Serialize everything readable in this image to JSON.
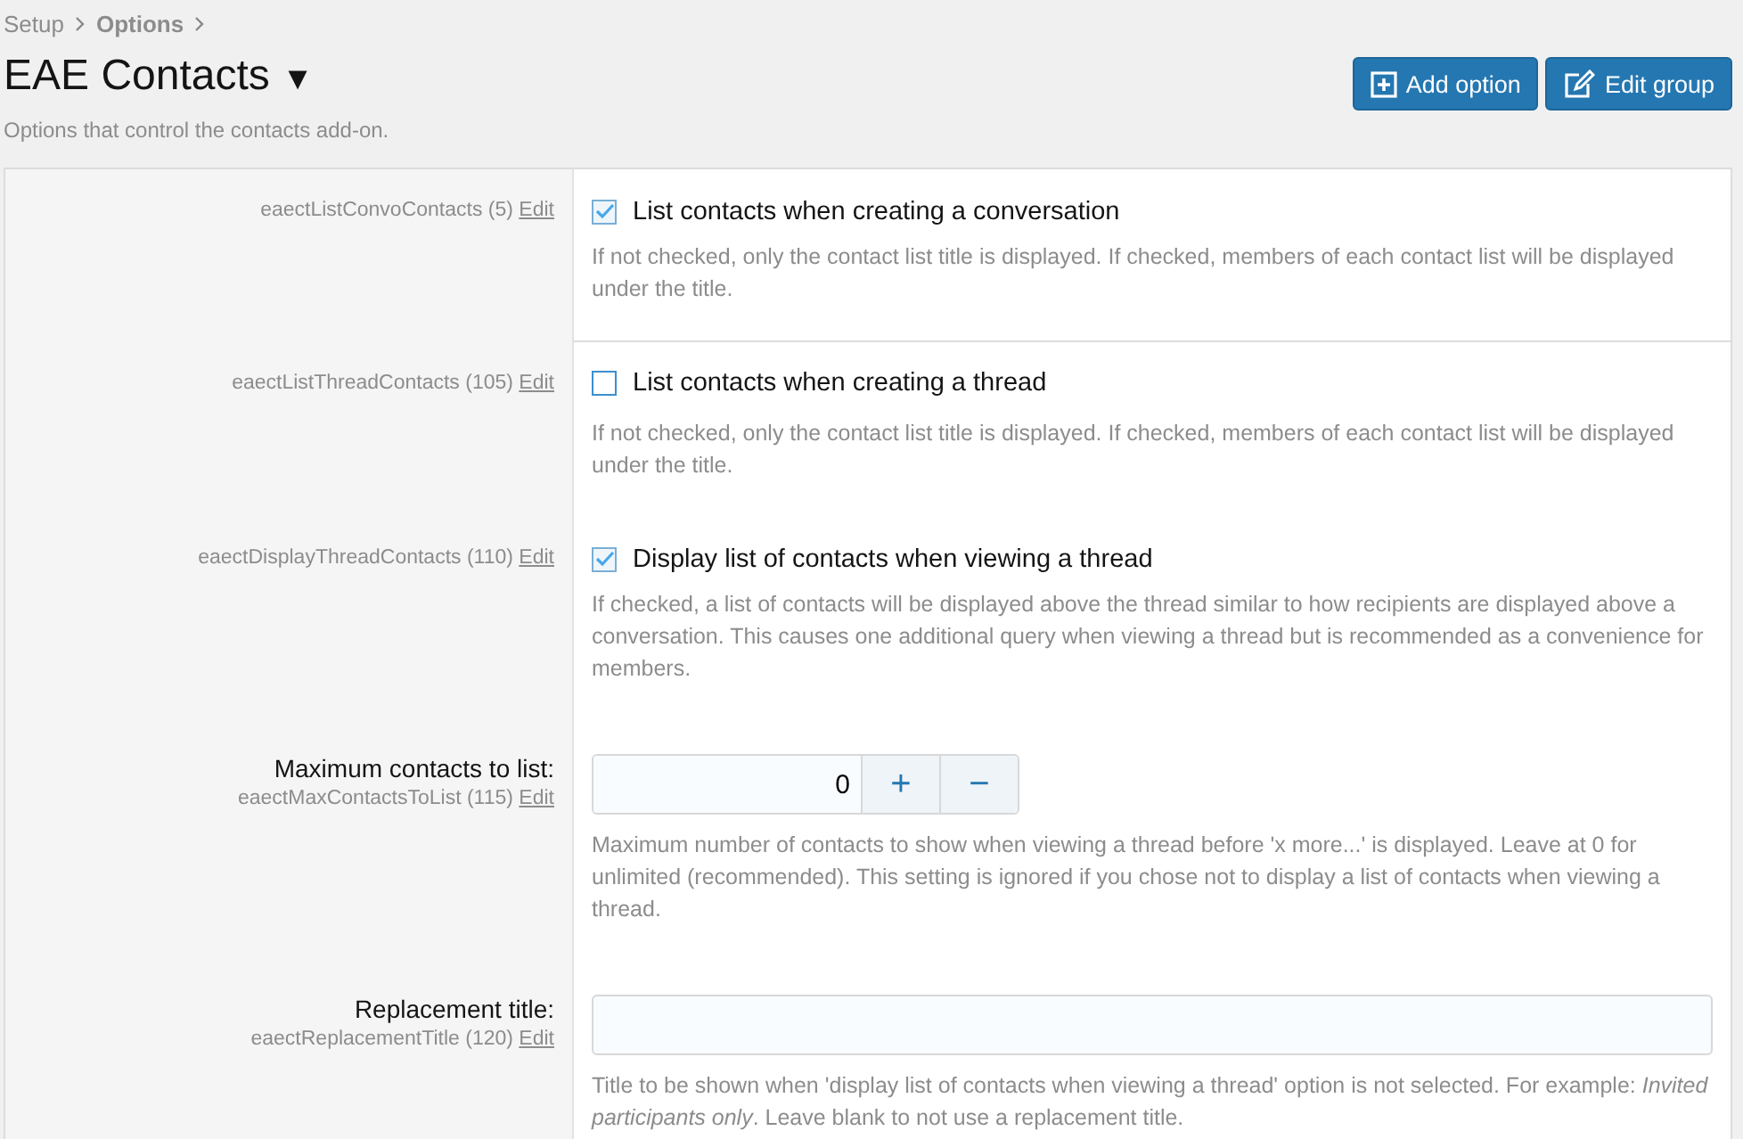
{
  "breadcrumb": [
    {
      "label": "Setup",
      "current": false
    },
    {
      "label": "Options",
      "current": true
    }
  ],
  "title": "EAE Contacts",
  "title_caret": "▼",
  "subtitle": "Options that control the contacts add-on.",
  "buttons": [
    {
      "label": "Add option",
      "kind": "add"
    },
    {
      "label": "Edit group",
      "kind": "edit"
    }
  ],
  "options": [
    {
      "kind": "checkbox",
      "option_id": "eaectListConvoContacts (5)",
      "edit": "Edit",
      "label": "List contacts when creating a conversation",
      "checked": true,
      "divider": true,
      "hint": "If not checked, only the contact list title is displayed. If checked, members of each contact list will be displayed under the title."
    },
    {
      "kind": "checkbox",
      "option_id": "eaectListThreadContacts (105)",
      "edit": "Edit",
      "label": "List contacts when creating a thread",
      "checked": false,
      "divider": false,
      "hint": "If not checked, only the contact list title is displayed. If checked, members of each contact list will be displayed under the title."
    },
    {
      "kind": "checkbox",
      "option_id": "eaectDisplayThreadContacts (110)",
      "edit": "Edit",
      "label": "Display list of contacts when viewing a thread",
      "checked": true,
      "divider": false,
      "hint": "If checked, a list of contacts will be displayed above the thread similar to how recipients are displayed above a conversation. This causes one additional query when viewing a thread but is recommended as a convenience for members."
    },
    {
      "kind": "number",
      "option_id": "eaectMaxContactsToList (115)",
      "edit": "Edit",
      "label": "Maximum contacts to list:",
      "value": "0",
      "plus": "+",
      "minus": "−",
      "divider": false,
      "hint": "Maximum number of contacts to show when viewing a thread before 'x more...' is displayed. Leave at 0 for unlimited (recommended). This setting is ignored if you chose not to display a list of contacts when viewing a thread."
    },
    {
      "kind": "text",
      "option_id": "eaectReplacementTitle (120)",
      "edit": "Edit",
      "label": "Replacement title:",
      "divider": false,
      "hint": "Title to be shown when 'display list of contacts when viewing a thread' option is not selected. For example: *Invited participants only*. Leave blank to not use a replacement title."
    }
  ]
}
